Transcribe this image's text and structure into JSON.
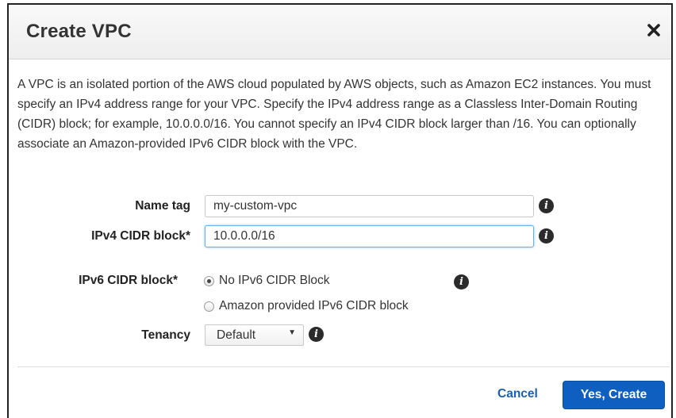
{
  "dialog": {
    "title": "Create VPC",
    "close_icon": "close-icon",
    "description": "A VPC is an isolated portion of the AWS cloud populated by AWS objects, such as Amazon EC2 instances. You must specify an IPv4 address range for your VPC. Specify the IPv4 address range as a Classless Inter-Domain Routing (CIDR) block; for example, 10.0.0.0/16. You cannot specify an IPv4 CIDR block larger than /16. You can optionally associate an Amazon-provided IPv6 CIDR block with the VPC."
  },
  "form": {
    "name_tag": {
      "label": "Name tag",
      "value": "my-custom-vpc"
    },
    "ipv4_cidr": {
      "label": "IPv4 CIDR block*",
      "value": "10.0.0.0/16"
    },
    "ipv6_cidr": {
      "label": "IPv6 CIDR block*",
      "options": [
        {
          "label": "No IPv6 CIDR Block",
          "checked": true
        },
        {
          "label": "Amazon provided IPv6 CIDR block",
          "checked": false
        }
      ]
    },
    "tenancy": {
      "label": "Tenancy",
      "selected": "Default"
    },
    "info_icon": "info-icon"
  },
  "footer": {
    "cancel_label": "Cancel",
    "create_label": "Yes, Create"
  },
  "colors": {
    "primary_button": "#0f5fc0",
    "link": "#1a5fb4",
    "focus": "#66afe9"
  }
}
